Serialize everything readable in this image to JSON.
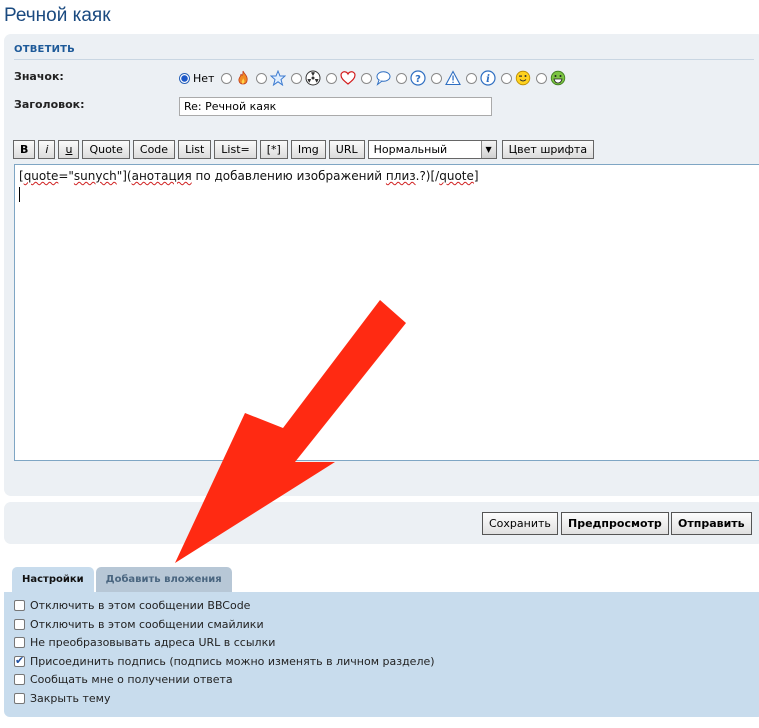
{
  "page": {
    "title": "Речной каяк"
  },
  "post": {
    "section_title": "ОТВЕТИТЬ",
    "icon_label": "Значок:",
    "subject_label": "Заголовок:",
    "subject_value": "Re: Речной каяк",
    "icons": [
      {
        "name": "none",
        "text": "Нет",
        "checked": true
      },
      {
        "name": "fire-icon"
      },
      {
        "name": "star-icon"
      },
      {
        "name": "radioactive-icon"
      },
      {
        "name": "heart-icon"
      },
      {
        "name": "speech-bubble-icon"
      },
      {
        "name": "question-icon"
      },
      {
        "name": "warning-icon"
      },
      {
        "name": "info-icon"
      },
      {
        "name": "wink-smiley-icon"
      },
      {
        "name": "grin-smiley-icon"
      }
    ]
  },
  "toolbar": {
    "bold": "B",
    "italic": "i",
    "underline": "u",
    "quote": "Quote",
    "code": "Code",
    "list": "List",
    "list_numbered": "List=",
    "list_item": "[*]",
    "img": "Img",
    "url": "URL",
    "font_size": "Нормальный",
    "font_color": "Цвет шрифта"
  },
  "editor": {
    "text_prefix": "[",
    "text_q1": "quote",
    "text_mid": "=\"",
    "text_user": "sunych",
    "text_after_user": "\"](",
    "text_w1": "анотация",
    "text_plain1": " по добавлению изображений ",
    "text_w2": "плиз",
    "text_plain2": ".?)[/",
    "text_q2": "quote",
    "text_end": "]"
  },
  "actions": {
    "save": "Сохранить",
    "preview": "Предпросмотр",
    "submit": "Отправить"
  },
  "tabs": {
    "settings": "Настройки",
    "attachments": "Добавить вложения"
  },
  "options": [
    {
      "label": "Отключить в этом сообщении BBCode",
      "checked": false
    },
    {
      "label": "Отключить в этом сообщении смайлики",
      "checked": false
    },
    {
      "label": "Не преобразовывать адреса URL в ссылки",
      "checked": false
    },
    {
      "label": "Присоединить подпись (подпись можно изменять в личном разделе)",
      "checked": true
    },
    {
      "label": "Сообщать мне о получении ответа",
      "checked": false
    },
    {
      "label": "Закрыть тему",
      "checked": false
    }
  ],
  "colors": {
    "accent": "#1e5a99",
    "panel_bg": "#ecf0f4",
    "options_bg": "#c8dced",
    "annotation_arrow": "#ff2a12"
  }
}
